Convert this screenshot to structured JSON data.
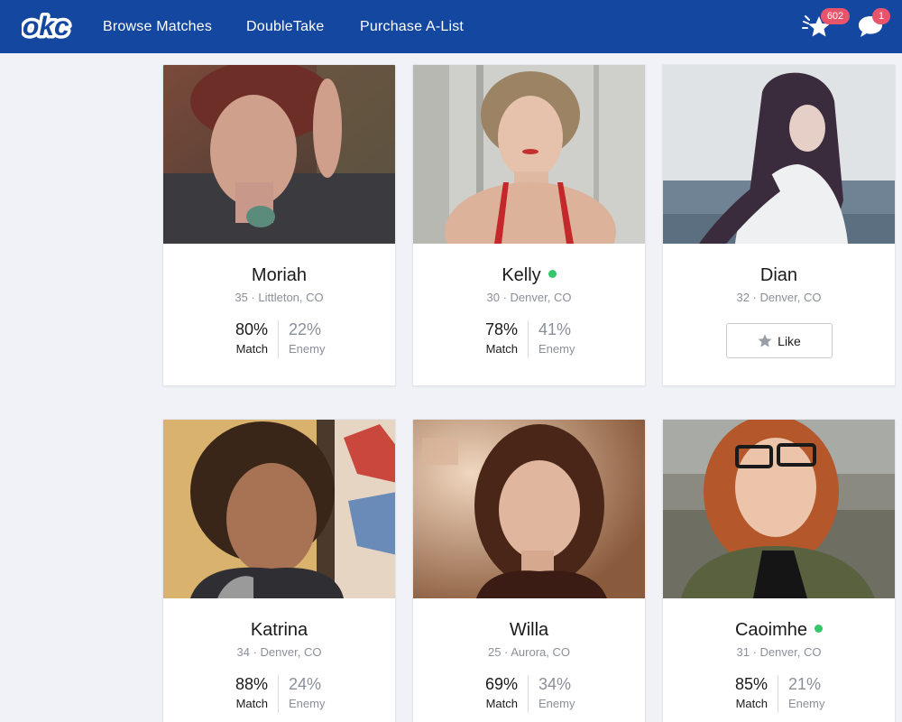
{
  "app": {
    "logo_text": "okc",
    "brand_color": "#1447a0"
  },
  "nav": {
    "links": [
      {
        "label": "Browse Matches"
      },
      {
        "label": "DoubleTake"
      },
      {
        "label": "Purchase A-List"
      }
    ],
    "notifications": {
      "stars_count": "602",
      "messages_count": "1"
    }
  },
  "icons": {
    "stars": "sparkle-star-icon",
    "messages": "speech-bubble-icon",
    "like": "star-icon",
    "online": "online-dot"
  },
  "colors": {
    "online": "#35c76b",
    "badge": "#e8546b"
  },
  "profiles": [
    {
      "name": "Moriah",
      "meta": "35 · Littleton, CO",
      "online": false,
      "match_pct": "80%",
      "match_label": "Match",
      "enemy_pct": "22%",
      "enemy_label": "Enemy"
    },
    {
      "name": "Kelly",
      "meta": "30 · Denver, CO",
      "online": true,
      "match_pct": "78%",
      "match_label": "Match",
      "enemy_pct": "41%",
      "enemy_label": "Enemy"
    },
    {
      "name": "Dian",
      "meta": "32 · Denver, CO",
      "online": false,
      "like_label": "Like"
    },
    {
      "name": "Katrina",
      "meta": "34 · Denver, CO",
      "online": false,
      "match_pct": "88%",
      "match_label": "Match",
      "enemy_pct": "24%",
      "enemy_label": "Enemy"
    },
    {
      "name": "Willa",
      "meta": "25 · Aurora, CO",
      "online": false,
      "match_pct": "69%",
      "match_label": "Match",
      "enemy_pct": "34%",
      "enemy_label": "Enemy"
    },
    {
      "name": "Caoimhe",
      "meta": "31 · Denver, CO",
      "online": true,
      "match_pct": "85%",
      "match_label": "Match",
      "enemy_pct": "21%",
      "enemy_label": "Enemy"
    }
  ]
}
